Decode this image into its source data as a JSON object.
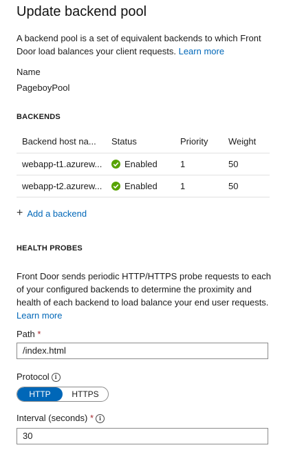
{
  "panel": {
    "title": "Update backend pool",
    "description": "A backend pool is a set of equivalent backends to which Front Door load balances your client requests.",
    "learn_more": "Learn more",
    "name_label": "Name",
    "name_value": "PageboyPool"
  },
  "backends": {
    "section_label": "BACKENDS",
    "columns": [
      "Backend host na...",
      "Status",
      "Priority",
      "Weight"
    ],
    "rows": [
      {
        "host": "webapp-t1.azurew...",
        "status": "Enabled",
        "priority": "1",
        "weight": "50"
      },
      {
        "host": "webapp-t2.azurew...",
        "status": "Enabled",
        "priority": "1",
        "weight": "50"
      }
    ],
    "add_label": "Add a backend"
  },
  "health": {
    "section_label": "HEALTH PROBES",
    "description": "Front Door sends periodic HTTP/HTTPS probe requests to each of your configured backends to determine the proximity and health of each backend to load balance your end user requests.",
    "learn_more": "Learn more",
    "path_label": "Path",
    "path_value": "/index.html",
    "protocol_label": "Protocol",
    "protocol_options": [
      "HTTP",
      "HTTPS"
    ],
    "protocol_selected": "HTTP",
    "interval_label": "Interval (seconds)",
    "interval_value": "30",
    "required_mark": "*"
  },
  "colors": {
    "accent": "#0067b8",
    "enabled_green": "#57a300",
    "required_red": "#a4262c"
  },
  "icons": {
    "status": "check-circle-icon",
    "add": "plus-icon",
    "info": "info-icon"
  }
}
